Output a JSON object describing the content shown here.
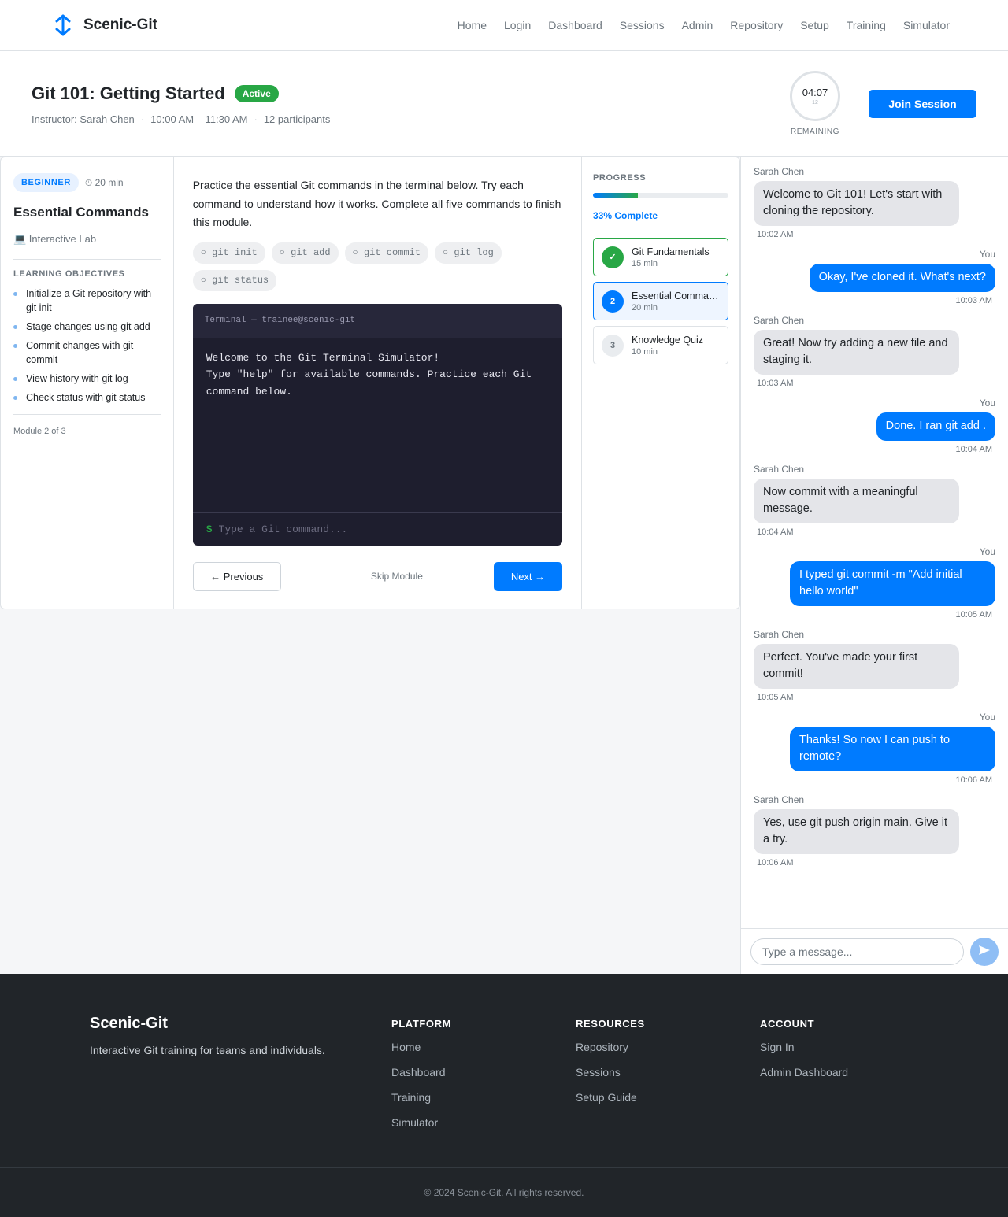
{
  "nav": {
    "brand": "Scenic-Git",
    "links": [
      "Home",
      "Login",
      "Dashboard",
      "Sessions",
      "Admin",
      "Repository",
      "Setup",
      "Training",
      "Simulator"
    ]
  },
  "session": {
    "title": "Git 101: Getting Started",
    "status": "Active",
    "instructor": "Instructor: Sarah Chen",
    "time": "10:00 AM – 11:30 AM",
    "participants": "12 participants",
    "timer": {
      "time": "04:07",
      "sub": "12",
      "label": "REMAINING"
    },
    "join_label": "Join Session"
  },
  "module": {
    "level": "BEGINNER",
    "duration": "⏱ 20 min",
    "title": "Essential Commands",
    "type": "💻 Interactive Lab",
    "objectives_title": "LEARNING OBJECTIVES",
    "objectives": [
      "Initialize a Git repository with git init",
      "Stage changes using git add",
      "Commit changes with git commit",
      "View history with git log",
      "Check status with git status"
    ],
    "position": "Module 2 of 3"
  },
  "lab": {
    "description": "Practice the essential Git commands in the terminal below. Try each command to understand how it works. Complete all five commands to finish this module.",
    "commands": [
      "○ git init",
      "○ git add",
      "○ git commit",
      "○ git log",
      "○ git status"
    ],
    "terminal": {
      "title": "Terminal — trainee@scenic-git",
      "output": "Welcome to the Git Terminal Simulator!\nType \"help\" for available commands. Practice each Git command below.",
      "prompt": "$",
      "placeholder": "Type a Git command..."
    },
    "prev_label": "← Previous",
    "skip_label": "Skip Module",
    "next_label": "Next →"
  },
  "progress": {
    "label": "PROGRESS",
    "percent": 33,
    "percent_label": "33% Complete",
    "modules": [
      {
        "marker": "✓",
        "name": "Git Fundamentals",
        "duration": "15 min",
        "state": "done"
      },
      {
        "marker": "2",
        "name": "Essential Commands",
        "duration": "20 min",
        "state": "current"
      },
      {
        "marker": "3",
        "name": "Knowledge Quiz",
        "duration": "10 min",
        "state": "upcoming"
      }
    ]
  },
  "chat": {
    "messages": [
      {
        "author": "Sarah Chen",
        "text": "Welcome to Git 101! Let's start with cloning the repository.",
        "time": "10:02 AM",
        "dir": "in"
      },
      {
        "author": "You",
        "text": "Okay, I've cloned it. What's next?",
        "time": "10:03 AM",
        "dir": "out"
      },
      {
        "author": "Sarah Chen",
        "text": "Great! Now try adding a new file and staging it.",
        "time": "10:03 AM",
        "dir": "in"
      },
      {
        "author": "You",
        "text": "Done. I ran git add .",
        "time": "10:04 AM",
        "dir": "out"
      },
      {
        "author": "Sarah Chen",
        "text": "Now commit with a meaningful message.",
        "time": "10:04 AM",
        "dir": "in"
      },
      {
        "author": "You",
        "text": "I typed git commit -m \"Add initial hello world\"",
        "time": "10:05 AM",
        "dir": "out"
      },
      {
        "author": "Sarah Chen",
        "text": "Perfect. You've made your first commit!",
        "time": "10:05 AM",
        "dir": "in"
      },
      {
        "author": "You",
        "text": "Thanks! So now I can push to remote?",
        "time": "10:06 AM",
        "dir": "out"
      },
      {
        "author": "Sarah Chen",
        "text": "Yes, use git push origin main. Give it a try.",
        "time": "10:06 AM",
        "dir": "in"
      }
    ],
    "input_placeholder": "Type a message..."
  },
  "footer": {
    "brand": "Scenic-Git",
    "tagline": "Interactive Git training for teams and individuals.",
    "columns": [
      {
        "title": "PLATFORM",
        "links": [
          "Home",
          "Dashboard",
          "Training",
          "Simulator"
        ]
      },
      {
        "title": "RESOURCES",
        "links": [
          "Repository",
          "Sessions",
          "Setup Guide"
        ]
      },
      {
        "title": "ACCOUNT",
        "links": [
          "Sign In",
          "Admin Dashboard"
        ]
      }
    ],
    "copyright": "© 2024 Scenic-Git. All rights reserved."
  },
  "colors": {
    "primary": "#007bff",
    "success": "#28a745",
    "terminal_bg": "#1e1e2e",
    "footer_bg": "#212529"
  }
}
